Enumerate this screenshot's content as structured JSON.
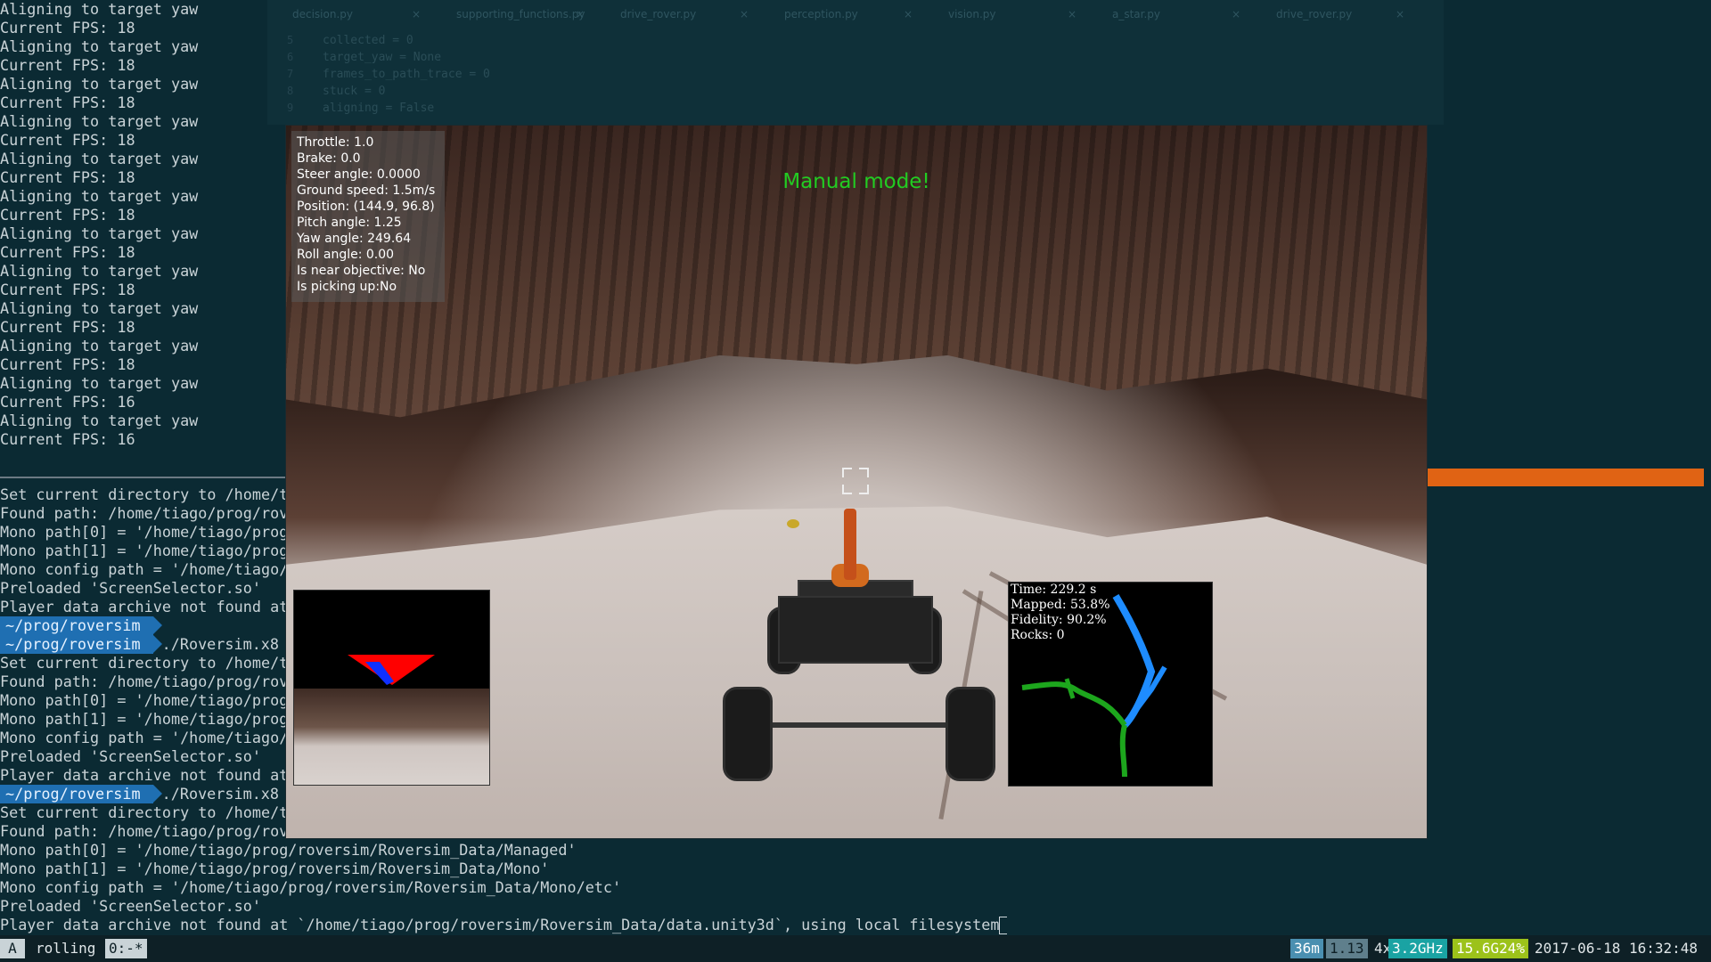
{
  "terminal_top": {
    "lines": [
      "Aligning to target yaw",
      "Current FPS: 18",
      "Aligning to target yaw",
      "Current FPS: 18",
      "Aligning to target yaw",
      "Current FPS: 18",
      "Aligning to target yaw",
      "Current FPS: 18",
      "Aligning to target yaw",
      "Current FPS: 18",
      "Aligning to target yaw",
      "Current FPS: 18",
      "Aligning to target yaw",
      "Current FPS: 18",
      "Aligning to target yaw",
      "Current FPS: 18",
      "Aligning to target yaw",
      "Current FPS: 18",
      "Aligning to target yaw",
      "Current FPS: 18",
      "Aligning to target yaw",
      "Current FPS: 16",
      "Aligning to target yaw",
      "Current FPS: 16"
    ]
  },
  "terminal_bottom": {
    "lines": [
      {
        "text": "Set current directory to /home/t"
      },
      {
        "text": "Found path: /home/tiago/prog/rov"
      },
      {
        "text": "Mono path[0] = '/home/tiago/prog"
      },
      {
        "text": "Mono path[1] = '/home/tiago/prog"
      },
      {
        "text": "Mono config path = '/home/tiago/"
      },
      {
        "text": "Preloaded 'ScreenSelector.so'"
      },
      {
        "text": "Player data archive not found at"
      },
      {
        "prompt": "~/prog/roversim",
        "text": ""
      },
      {
        "prompt": "~/prog/roversim",
        "text": " ./Roversim.x8"
      },
      {
        "text": "Set current directory to /home/t"
      },
      {
        "text": "Found path: /home/tiago/prog/rov"
      },
      {
        "text": "Mono path[0] = '/home/tiago/prog"
      },
      {
        "text": "Mono path[1] = '/home/tiago/prog"
      },
      {
        "text": "Mono config path = '/home/tiago/"
      },
      {
        "text": "Preloaded 'ScreenSelector.so'"
      },
      {
        "text": "Player data archive not found at"
      },
      {
        "prompt": "~/prog/roversim",
        "text": " ./Roversim.x8"
      },
      {
        "text": "Set current directory to /home/t"
      },
      {
        "text": "Found path: /home/tiago/prog/rov"
      },
      {
        "text": "Mono path[0] = '/home/tiago/prog/roversim/Roversim_Data/Managed'"
      },
      {
        "text": "Mono path[1] = '/home/tiago/prog/roversim/Roversim_Data/Mono'"
      },
      {
        "text": "Mono config path = '/home/tiago/prog/roversim/Roversim_Data/Mono/etc'"
      },
      {
        "text": "Preloaded 'ScreenSelector.so'"
      },
      {
        "text": "Player data archive not found at `/home/tiago/prog/roversim/Roversim_Data/data.unity3d`, using local filesystem",
        "cursor": true
      }
    ]
  },
  "editor": {
    "tabs": [
      "decision.py",
      "supporting_functions.py",
      "drive_rover.py",
      "perception.py",
      "vision.py",
      "a_star.py",
      "drive_rover.py"
    ],
    "gutter": [
      "5",
      "6",
      "7",
      "8",
      "9"
    ],
    "code": [
      "collected = 0",
      "target_yaw = None",
      "frames_to_path_trace = 0",
      "stuck = 0",
      "aligning = False"
    ]
  },
  "sim": {
    "hud": [
      "Throttle: 1.0",
      "Brake: 0.0",
      "Steer angle: 0.0000",
      "Ground speed: 1.5m/s",
      "Position: (144.9, 96.8)",
      "Pitch angle: 1.25",
      "Yaw angle: 249.64",
      "Roll angle: 0.00",
      "Is near objective: No",
      "Is picking up:No"
    ],
    "mode_text": "Manual mode!",
    "map_stats": [
      "Time: 229.2 s",
      "Mapped: 53.8%",
      "Fidelity: 90.2%",
      "Rocks: 0"
    ]
  },
  "statusbar": {
    "a": "A",
    "session": "rolling",
    "window": "0:-*",
    "uptime": "36m",
    "load": "1.13",
    "cpu_count": "4x",
    "cpu_freq": "3.2GHz",
    "mem": "15.6G24%",
    "datetime": "2017-06-18 16:32:48"
  },
  "colors": {
    "mode_text": "#22cc22",
    "prompt_bg": "#1f6fb2",
    "orange_bar": "#e06314"
  }
}
